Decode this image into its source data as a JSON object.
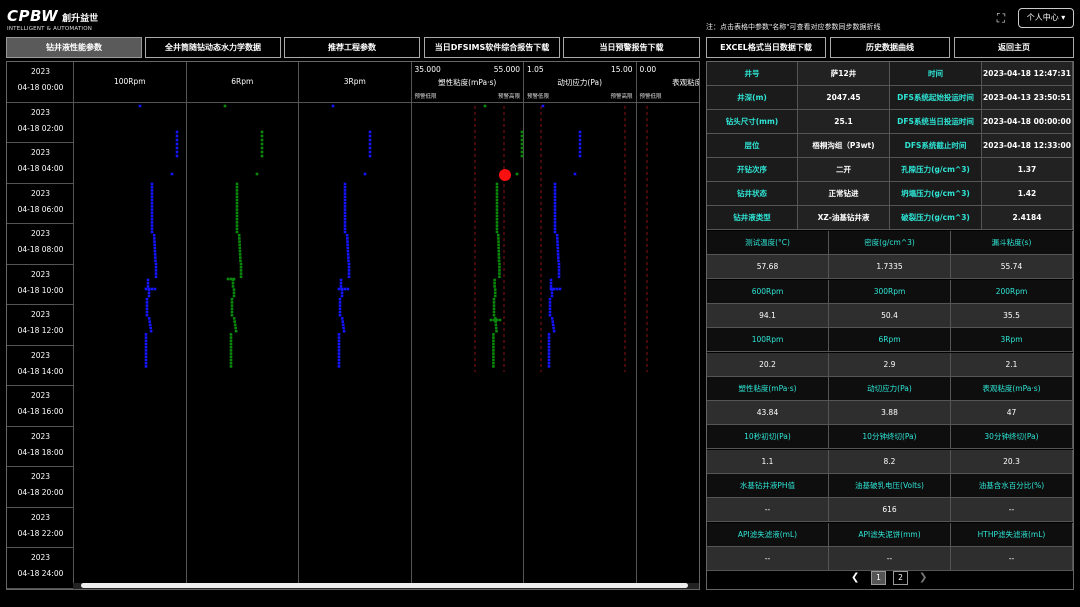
{
  "header": {
    "logo_main": "CPBW",
    "logo_cn": "創升益世",
    "logo_sub": "INTELLIGENT & AUTOMATION",
    "note": "注：点击表格中参数\"名称\"可查看对应参数同步数据折线",
    "expand_icon": "⛶",
    "user_label": "个人中心 ▾"
  },
  "tabs_left": [
    "钻井液性能参数",
    "全井筒随钻动态水力学数据",
    "推荐工程参数",
    "当日DFSIMS软件综合报告下载",
    "当日预警报告下载"
  ],
  "tabs_right": [
    "EXCEL格式当日数据下载",
    "历史数据曲线",
    "返回主页"
  ],
  "time_axis": [
    {
      "year": "2023",
      "time": "04-18 00:00"
    },
    {
      "year": "2023",
      "time": "04-18 02:00"
    },
    {
      "year": "2023",
      "time": "04-18 04:00"
    },
    {
      "year": "2023",
      "time": "04-18 06:00"
    },
    {
      "year": "2023",
      "time": "04-18 08:00"
    },
    {
      "year": "2023",
      "time": "04-18 10:00"
    },
    {
      "year": "2023",
      "time": "04-18 12:00"
    },
    {
      "year": "2023",
      "time": "04-18 14:00"
    },
    {
      "year": "2023",
      "time": "04-18 16:00"
    },
    {
      "year": "2023",
      "time": "04-18 18:00"
    },
    {
      "year": "2023",
      "time": "04-18 20:00"
    },
    {
      "year": "2023",
      "time": "04-18 22:00"
    },
    {
      "year": "2023",
      "time": "04-18 24:00"
    }
  ],
  "tracks": [
    {
      "name": "100Rpm",
      "min": "",
      "max": "",
      "lo": "",
      "hi": ""
    },
    {
      "name": "6Rpm",
      "min": "",
      "max": "",
      "lo": "",
      "hi": ""
    },
    {
      "name": "3Rpm",
      "min": "",
      "max": "",
      "lo": "",
      "hi": ""
    },
    {
      "name": "塑性粘度(mPa·s)",
      "min": "35.000",
      "max": "55.000",
      "lo": "预警低限",
      "hi": "预警高限"
    },
    {
      "name": "动切应力(Pa)",
      "min": "1.05",
      "max": "15.00",
      "lo": "预警低限",
      "hi": "预警高限"
    },
    {
      "name": "表观粘度(m",
      "min": "0.00",
      "max": "",
      "lo": "预警低限",
      "hi": "预警高限"
    }
  ],
  "colors": {
    "blue": "#1515ff",
    "green": "#0a8a0a",
    "alarm": "#ff1010",
    "accent": "#2ee6d6"
  },
  "info": [
    {
      "k1": "井号",
      "v1": "萨12井",
      "k2": "时间",
      "v2": "2023-04-18 12:47:31"
    },
    {
      "k1": "井深(m)",
      "v1": "2047.45",
      "k2": "DFS系统起始投运时间",
      "v2": "2023-04-13 23:50:51"
    },
    {
      "k1": "钻头尺寸(mm)",
      "v1": "25.1",
      "k2": "DFS系统当日投运时间",
      "v2": "2023-04-18 00:00:00"
    },
    {
      "k1": "层位",
      "v1": "梧桐沟组（P3wt)",
      "k2": "DFS系统截止时间",
      "v2": "2023-04-18 12:33:00"
    },
    {
      "k1": "开钻次序",
      "v1": "二开",
      "k2": "孔隙压力(g/cm^3)",
      "v2": "1.37"
    },
    {
      "k1": "钻井状态",
      "v1": "正常钻进",
      "k2": "坍塌压力(g/cm^3)",
      "v2": "1.42"
    },
    {
      "k1": "钻井液类型",
      "v1": "XZ-油基钻井液",
      "k2": "破裂压力(g/cm^3)",
      "v2": "2.4184"
    }
  ],
  "params": [
    {
      "h": [
        "测试温度(°C)",
        "密度(g/cm^3)",
        "漏斗粘度(s)"
      ],
      "v": [
        "57.68",
        "1.7335",
        "55.74"
      ]
    },
    {
      "h": [
        "600Rpm",
        "300Rpm",
        "200Rpm"
      ],
      "v": [
        "94.1",
        "50.4",
        "35.5"
      ]
    },
    {
      "h": [
        "100Rpm",
        "6Rpm",
        "3Rpm"
      ],
      "v": [
        "20.2",
        "2.9",
        "2.1"
      ]
    },
    {
      "h": [
        "塑性粘度(mPa·s)",
        "动切应力(Pa)",
        "表观粘度(mPa·s)"
      ],
      "v": [
        "43.84",
        "3.88",
        "47"
      ]
    },
    {
      "h": [
        "10秒初切(Pa)",
        "10分钟终切(Pa)",
        "30分钟终切(Pa)"
      ],
      "v": [
        "1.1",
        "8.2",
        "20.3"
      ]
    },
    {
      "h": [
        "水基钻井液PH值",
        "油基破乳电压(Volts)",
        "油基含水百分比(%)"
      ],
      "v": [
        "--",
        "616",
        "--"
      ]
    },
    {
      "h": [
        "API滤失滤液(mL)",
        "API滤失泥饼(mm)",
        "HTHP滤失滤液(mL)"
      ],
      "v": [
        "--",
        "--",
        "--"
      ]
    }
  ],
  "pager": {
    "prev": "❮",
    "next": "❯",
    "pages": [
      "1",
      "2"
    ]
  }
}
